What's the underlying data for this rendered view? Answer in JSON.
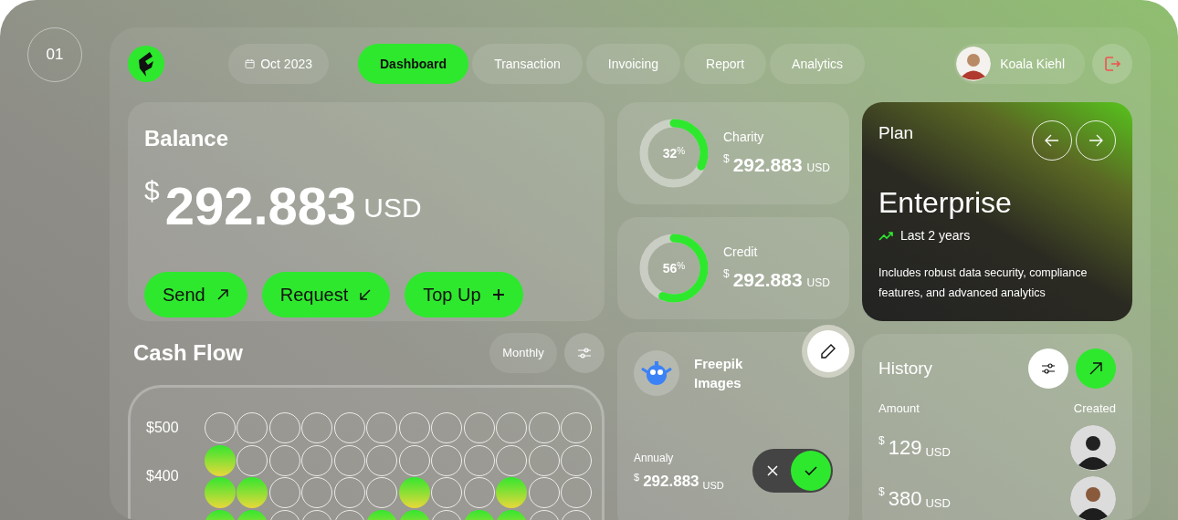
{
  "page_number": "01",
  "nav": {
    "date": "Oct 2023",
    "tabs": [
      {
        "label": "Dashboard",
        "selected": true
      },
      {
        "label": "Transaction",
        "selected": false
      },
      {
        "label": "Invoicing",
        "selected": false
      },
      {
        "label": "Report",
        "selected": false
      },
      {
        "label": "Analytics",
        "selected": false
      }
    ],
    "user": {
      "name": "Koala Kiehl"
    }
  },
  "balance": {
    "title": "Balance",
    "currency_symbol": "$",
    "amount": "292.883",
    "currency": "USD",
    "actions": [
      {
        "label": "Send",
        "kind": "send"
      },
      {
        "label": "Request",
        "kind": "request"
      },
      {
        "label": "Top Up",
        "kind": "topup"
      }
    ]
  },
  "cash_flow": {
    "title": "Cash Flow",
    "period": "Monthly",
    "y_labels": [
      "$500",
      "$400"
    ],
    "rows": [
      {
        "dots": [
          false,
          false,
          false,
          false,
          false,
          false,
          false,
          false,
          false,
          false,
          false,
          false
        ]
      },
      {
        "dots": [
          true,
          false,
          false,
          false,
          false,
          false,
          false,
          false,
          false,
          false,
          false,
          false
        ]
      },
      {
        "dots": [
          true,
          true,
          false,
          false,
          false,
          false,
          true,
          false,
          false,
          true,
          false,
          false
        ]
      },
      {
        "dots": [
          true,
          true,
          false,
          false,
          false,
          true,
          true,
          false,
          true,
          true,
          false,
          false
        ]
      }
    ]
  },
  "stats": [
    {
      "label": "Charity",
      "percent": "32",
      "percent_sign": "%",
      "level": 0.32,
      "currency_symbol": "$",
      "amount": "292.883",
      "currency": "USD"
    },
    {
      "label": "Credit",
      "percent": "56",
      "percent_sign": "%",
      "level": 0.56,
      "currency_symbol": "$",
      "amount": "292.883",
      "currency": "USD"
    }
  ],
  "plan": {
    "title": "Plan",
    "name": "Enterprise",
    "period": "Last 2 years",
    "description": "Includes robust data security, compliance features, and advanced analytics"
  },
  "subscription": {
    "name": "Freepik Images",
    "billing": "Annualy",
    "currency_symbol": "$",
    "amount": "292.883",
    "currency": "USD",
    "on": true
  },
  "history": {
    "title": "History",
    "columns": [
      "Amount",
      "Created"
    ],
    "rows": [
      {
        "currency_symbol": "$",
        "amount": "129",
        "currency": "USD"
      },
      {
        "currency_symbol": "$",
        "amount": "380",
        "currency": "USD"
      }
    ]
  }
}
